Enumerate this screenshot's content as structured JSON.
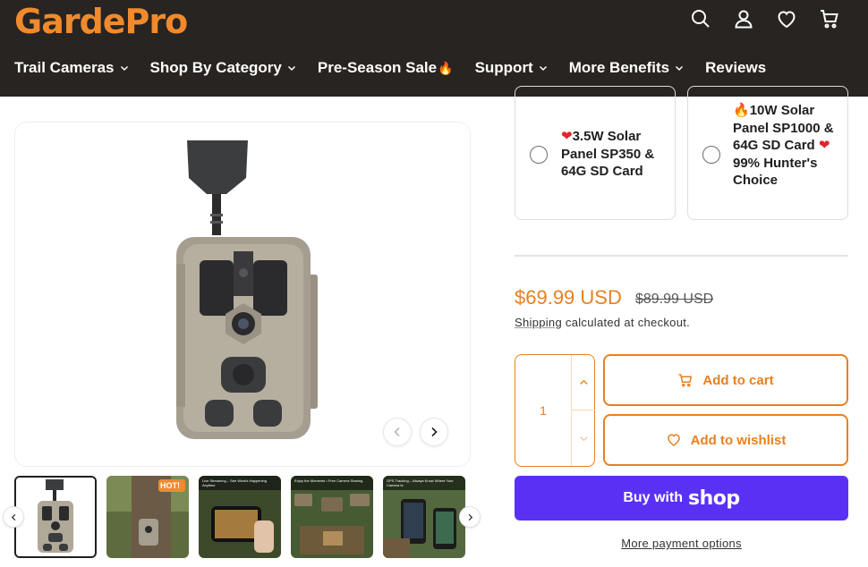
{
  "header": {
    "logo": "GardePro",
    "icons": [
      "search-icon",
      "account-icon",
      "wishlist-heart-icon",
      "cart-icon"
    ]
  },
  "nav": {
    "items": [
      {
        "label": "Trail Cameras",
        "has_dropdown": true
      },
      {
        "label": "Shop By Category",
        "has_dropdown": true
      },
      {
        "label": "Pre-Season Sale",
        "has_dropdown": false,
        "emoji": "🔥"
      },
      {
        "label": "Support",
        "has_dropdown": true
      },
      {
        "label": "More Benefits",
        "has_dropdown": true
      },
      {
        "label": "Reviews",
        "has_dropdown": false
      }
    ]
  },
  "gallery": {
    "prev_icon": "chevron-left-icon",
    "next_icon": "chevron-right-icon",
    "thumbnails": [
      {
        "name": "thumb-camera",
        "active": true
      },
      {
        "name": "thumb-tree-mount",
        "active": false,
        "badge": "HOT!"
      },
      {
        "name": "thumb-live-streaming",
        "active": false,
        "caption": "Live Streaming – See What's Happening Anytime"
      },
      {
        "name": "thumb-enjoy-moments",
        "active": false,
        "caption": "Enjoy the Moments • Free Camera Sharing"
      },
      {
        "name": "thumb-gps-tracking",
        "active": false,
        "caption": "GPS Tracking – Always Know Where Your Camera Is"
      }
    ]
  },
  "bundles": [
    {
      "heart": "❤",
      "text": "3.5W Solar Panel SP350 & 64G SD Card"
    },
    {
      "flame": "🔥",
      "line1": "10W Solar Panel SP1000 & 64G SD Card",
      "heart": "❤",
      "line2": "99% Hunter's Choice"
    }
  ],
  "pricing": {
    "price": "$69.99 USD",
    "compare_at": "$89.99 USD",
    "shipping_link": "Shipping",
    "shipping_note": " calculated at checkout."
  },
  "quantity": {
    "value": "1"
  },
  "buttons": {
    "add_to_cart": "Add to cart",
    "add_to_wishlist": "Add to wishlist",
    "buy_with": "Buy with",
    "shop": "shop",
    "more_payment": "More payment options"
  },
  "colors": {
    "brand_orange": "#e8801f",
    "header_bg": "#272422",
    "shop_pay_purple": "#5a31f4",
    "heart_red": "#e0262c"
  }
}
